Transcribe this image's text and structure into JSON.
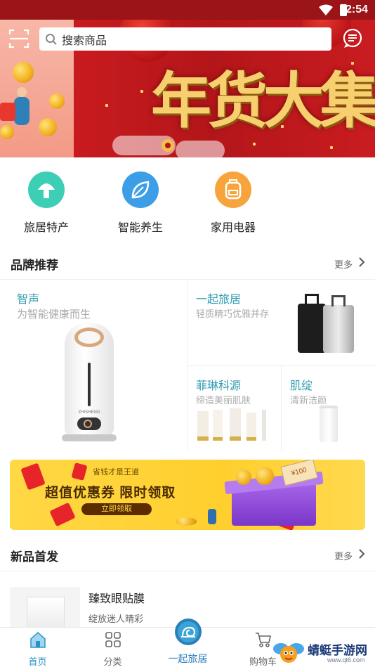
{
  "status_bar": {
    "time": "2:54"
  },
  "header": {
    "search_placeholder": "搜索商品"
  },
  "banner": {
    "headline": "年货大集"
  },
  "categories": [
    {
      "label": "旅居特产",
      "icon": "mushroom-icon",
      "color": "#3dcfb5"
    },
    {
      "label": "智能养生",
      "icon": "leaf-icon",
      "color": "#3d9ee8"
    },
    {
      "label": "家用电器",
      "icon": "backpack-icon",
      "color": "#f7a43c"
    }
  ],
  "brand_section": {
    "title": "品牌推荐",
    "more": "更多",
    "brands": [
      {
        "name": "智声",
        "sub": "为智能健康而生"
      },
      {
        "name": "一起旅居",
        "sub": "轻质精巧优雅并存"
      },
      {
        "name": "菲琳科源",
        "sub": "缔造美丽肌肤"
      },
      {
        "name": "肌绽",
        "sub": "清新洁颜"
      }
    ],
    "humidifier_brand_text": "ZHISHENG"
  },
  "coupon": {
    "small_text": "省钱才是王道",
    "headline": "超值优惠券 限时领取",
    "button": "立即领取",
    "cash_label": "¥100"
  },
  "new_section": {
    "title": "新品首发",
    "more": "更多",
    "item": {
      "name": "臻致眼贴膜",
      "desc": "绽放迷人晴彩"
    }
  },
  "bottom_nav": [
    {
      "label": "首页",
      "icon": "home-icon",
      "active": true
    },
    {
      "label": "分类",
      "icon": "grid-icon",
      "active": false
    },
    {
      "label": "一起旅居",
      "icon": "snail-logo-icon",
      "active": false
    },
    {
      "label": "购物车",
      "icon": "cart-icon",
      "active": false
    }
  ],
  "watermark": {
    "text": "蜻蜓手游网",
    "url": "www.qt6.com"
  },
  "colors": {
    "brand_teal": "#2e9bb0",
    "nav_active": "#2a93c8",
    "banner_red": "#b3161a"
  }
}
